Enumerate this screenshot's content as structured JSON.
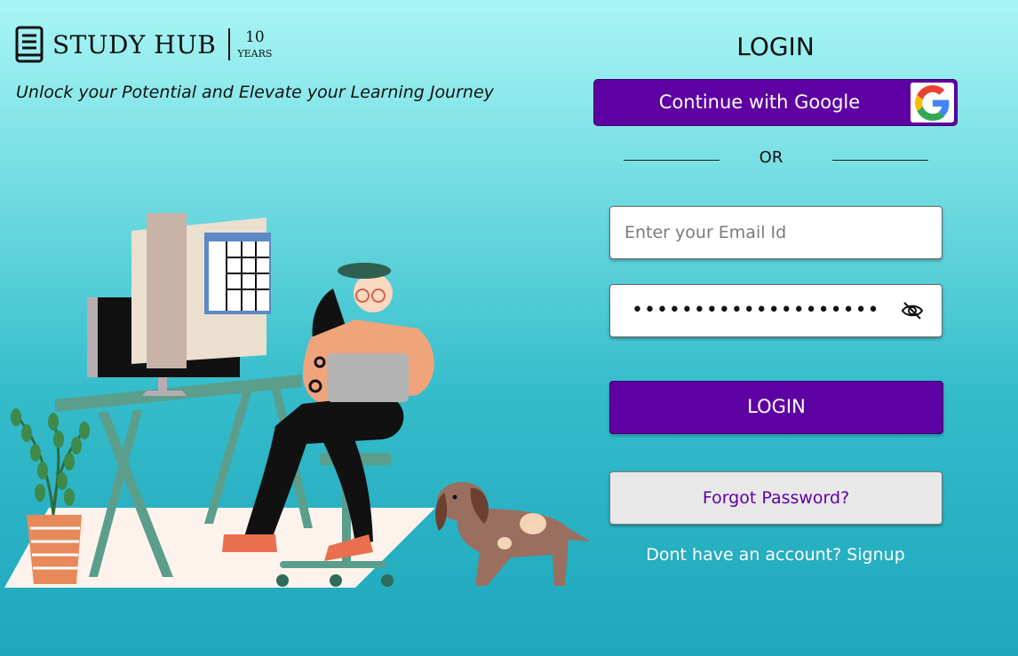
{
  "brand": {
    "name": "STUDY HUB",
    "years_number": "10",
    "years_word": "YEARS",
    "tagline": "Unlock your Potential and Elevate your Learning Journey",
    "icon": "book-icon"
  },
  "login": {
    "title": "LOGIN",
    "google_button": "Continue with Google",
    "google_icon": "google-icon",
    "or_text": "OR",
    "email_placeholder": "Enter your Email Id",
    "password_mask": "••••••••••••••••••••",
    "password_toggle_icon": "eye-off-icon",
    "login_button": "LOGIN",
    "forgot_button": "Forgot Password?",
    "signup_text": "Dont have an account? Signup"
  },
  "colors": {
    "primary_purple": "#5e01a2",
    "background_top": "#a9f5f5",
    "background_bottom": "#1ea6bc"
  }
}
